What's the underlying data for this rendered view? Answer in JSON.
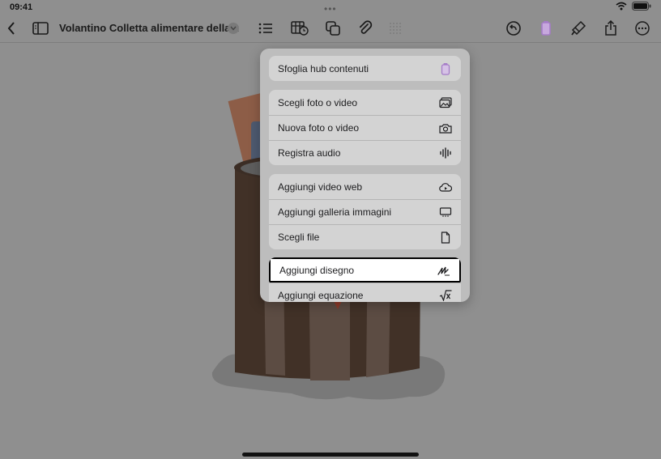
{
  "status": {
    "time": "09:41"
  },
  "toolbar": {
    "title": "Volantino Colletta alimentare della..."
  },
  "menu": {
    "groups": [
      {
        "items": [
          {
            "label": "Sfoglia hub contenuti"
          }
        ]
      },
      {
        "items": [
          {
            "label": "Scegli foto o video"
          },
          {
            "label": "Nuova foto o video"
          },
          {
            "label": "Registra audio"
          }
        ]
      },
      {
        "items": [
          {
            "label": "Aggiungi video web"
          },
          {
            "label": "Aggiungi galleria immagini"
          },
          {
            "label": "Scegli file"
          }
        ]
      },
      {
        "items": [
          {
            "label": "Aggiungi disegno"
          },
          {
            "label": "Aggiungi equazione"
          }
        ]
      }
    ]
  },
  "colors": {
    "accent": "#a57cc7",
    "dim_background": "#8f8f8f",
    "selection_border": "#000000"
  }
}
